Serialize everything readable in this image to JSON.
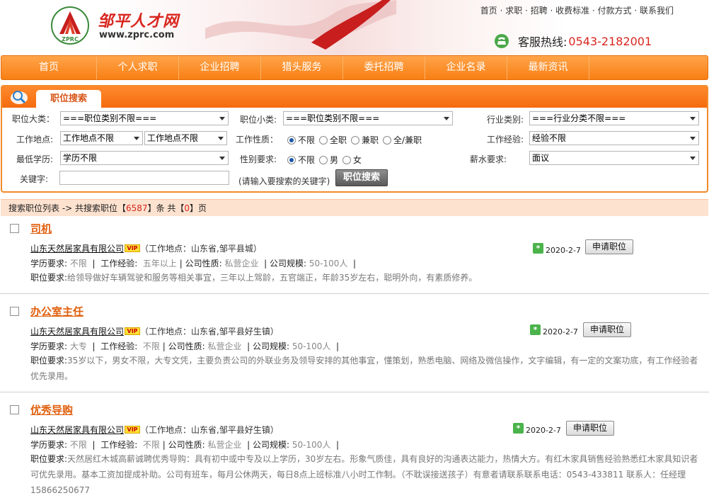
{
  "site": {
    "brand_name": "邹平人才网",
    "url": "www.zprc.com",
    "logo_text": "ZPRC",
    "top_links": "首页 · 求职 · 招聘 · 收费标准 · 付款方式 · 联系我们",
    "hotline_label": "客服热线:",
    "hotline_number": "0543-2182001"
  },
  "nav": [
    "首页",
    "个人求职",
    "企业招聘",
    "猎头服务",
    "委托招聘",
    "企业名录",
    "最新资讯"
  ],
  "search": {
    "tab_title": "职位搜索",
    "labels": {
      "category": "职位大类：",
      "subcategory": "职位小类:",
      "industry": "行业类别:",
      "location": "工作地点:",
      "nature": "工作性质：",
      "experience": "工作经验:",
      "education": "最低学历:",
      "gender": "性别要求:",
      "salary": "薪水要求:",
      "keyword": "关键字:"
    },
    "category_value": "===职位类别不限===",
    "subcategory_value": "===职位类别不限===",
    "industry_value": "===行业分类不限===",
    "location_value_1": "工作地点不限",
    "location_value_2": "工作地点不限",
    "nature_options": [
      "不限",
      "全职",
      "兼职",
      "全/兼职"
    ],
    "experience_value": "经验不限",
    "education_value": "学历不限",
    "gender_options": [
      "不限",
      "男",
      "女"
    ],
    "salary_value": "面议",
    "keyword_hint": "(请输入要搜索的关键字)",
    "button": "职位搜索"
  },
  "results": {
    "prefix": "搜索职位列表 -> 共搜索职位【",
    "count": "6587",
    "mid": "】条 共【",
    "pages": "0",
    "suffix": "】页"
  },
  "job_labels": {
    "education": "学历要求:",
    "experience": "工作经验:",
    "nature": "公司性质:",
    "scale": "公司规模:",
    "duties": "职位要求:",
    "apply": "申请职位",
    "vip": "VIP"
  },
  "jobs": [
    {
      "title": "司机",
      "company": "山东天然居家具有限公司",
      "location": "（工作地点：山东省,邹平县城）",
      "education": "不限",
      "experience": "五年以上",
      "nature": "私营企业",
      "scale": "50-100人",
      "duties": "给领导做好车辆驾驶和服务等相关事宜，三年以上驾龄，五官端正，年龄35岁左右，聪明外向，有素质修养。",
      "date": "2020-2-7"
    },
    {
      "title": "办公室主任",
      "company": "山东天然居家具有限公司",
      "location": "（工作地点：山东省,邹平县好生镇）",
      "education": "大专",
      "experience": "不限",
      "nature": "私营企业",
      "scale": "50-100人",
      "duties": "35岁以下，男女不限，大专文凭，主要负责公司的外联业务及领导安排的其他事宜，懂策划，熟悉电脑、网络及微信操作，文字编辑，有一定的文案功底，有工作经验者优先录用。",
      "date": "2020-2-7"
    },
    {
      "title": "优秀导购",
      "company": "山东天然居家具有限公司",
      "location": "（工作地点：山东省,邹平县好生镇）",
      "education": "不限",
      "experience": "不限",
      "nature": "私营企业",
      "scale": "50-100人",
      "duties": "天然居红木城高薪诚聘优秀导购：具有初中或中专及以上学历，30岁左右。形象气质佳，具有良好的沟通表达能力，热情大方。有红木家具销售经验熟悉红木家具知识者可优先录用。基本工资加提成补助。公司有班车，每月公休两天，每日8点上班标准八小时工作制。（不耽误接送孩子）有意者请联系联系电话：0543-433811 联系人：任经理 15866250677",
      "date": "2020-2-7"
    }
  ]
}
